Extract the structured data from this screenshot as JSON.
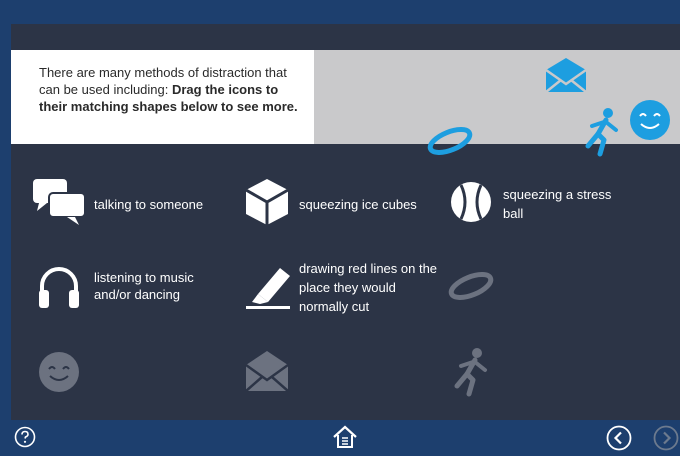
{
  "intro": {
    "text_plain": "There are many methods of distraction that can be used including: ",
    "text_bold": "Drag the icons to their matching shapes below to see more."
  },
  "items": [
    {
      "label": "talking to someone",
      "icon": "speech-bubbles-icon"
    },
    {
      "label": "squeezing ice cubes",
      "icon": "ice-cube-icon"
    },
    {
      "label": "squeezing a stress ball",
      "icon": "stress-ball-icon"
    },
    {
      "label": "listening to music and/or dancing",
      "icon": "headphones-icon"
    },
    {
      "label": "drawing red lines on the place they would normally cut",
      "icon": "marker-icon"
    }
  ],
  "draggables": [
    "envelope-icon",
    "smiley-icon",
    "wristband-icon",
    "running-person-icon"
  ],
  "slots": [
    "wristband-slot-icon",
    "smiley-slot-icon",
    "envelope-slot-icon",
    "running-person-slot-icon"
  ],
  "footer": {
    "help": "help-icon",
    "home": "home-icon",
    "back": "back-arrow-icon",
    "next": "next-arrow-icon"
  },
  "colors": {
    "accent_blue": "#1d9ee0",
    "panel": "#2c3446",
    "footer": "#1d3f6e",
    "slot_gray": "#6c7280"
  }
}
